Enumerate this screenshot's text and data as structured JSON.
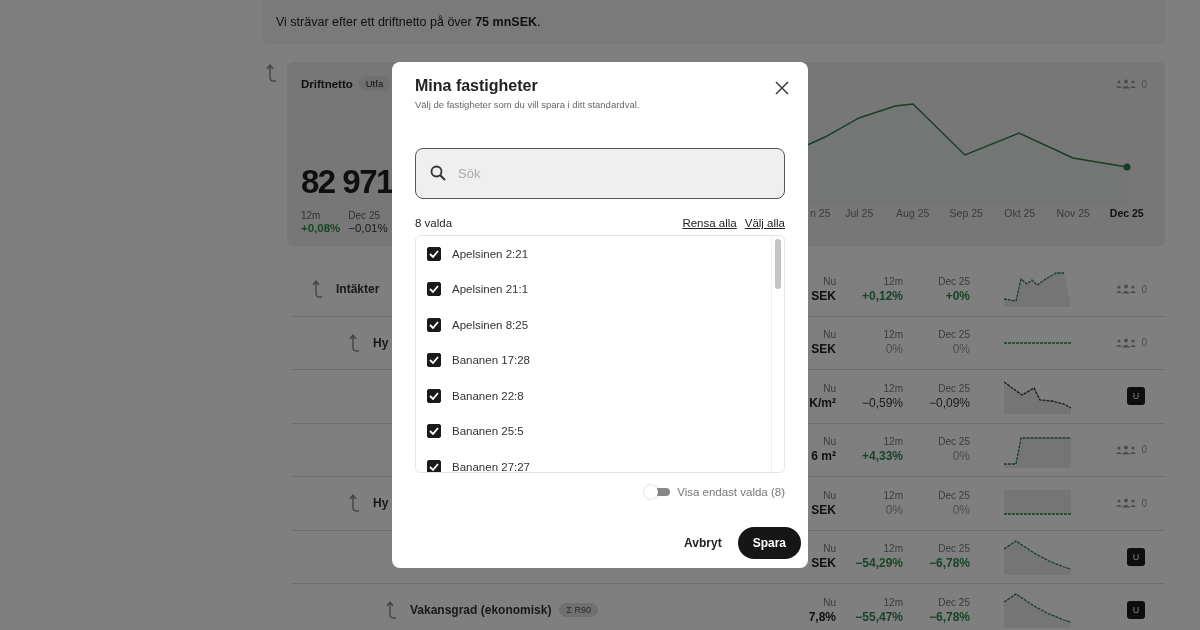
{
  "goal_banner": {
    "text": "Vi strävar efter ett driftnetto på över **75 mnSEK**."
  },
  "summary_card": {
    "title": "Driftnetto",
    "badge": "Utfa",
    "value": "82 971",
    "watchers": "0",
    "stats": [
      {
        "label": "12m",
        "value": "+0,08%",
        "kind": "good"
      },
      {
        "label": "Dec 25",
        "value": "−0,01%",
        "kind": "plain"
      }
    ],
    "months": [
      {
        "label": "n 25",
        "selected": false
      },
      {
        "label": "Jul 25",
        "selected": false
      },
      {
        "label": "Aug 25",
        "selected": false
      },
      {
        "label": "Sep 25",
        "selected": false
      },
      {
        "label": "Okt 25",
        "selected": false
      },
      {
        "label": "Nov 25",
        "selected": false
      },
      {
        "label": "Dec 25",
        "selected": true
      }
    ]
  },
  "rows": [
    {
      "name": "Intäkter",
      "sparkline": {
        "kind": "rise"
      },
      "marker": {
        "kind": "watchers",
        "text": "0"
      },
      "metrics": [
        {
          "label": "Nu",
          "value": "SEK",
          "kind": "strong"
        },
        {
          "label": "12m",
          "value": "+0,12%",
          "kind": "good"
        },
        {
          "label": "Dec 25",
          "value": "+0%",
          "kind": "good"
        }
      ],
      "children": [
        {
          "name": "Hy",
          "sparkline": {
            "kind": "flat"
          },
          "marker": {
            "kind": "watchers",
            "text": "0"
          },
          "metrics": [
            {
              "label": "Nu",
              "value": "SEK",
              "kind": "strong"
            },
            {
              "label": "12m",
              "value": "0%",
              "kind": "flat"
            },
            {
              "label": "Dec 25",
              "value": "0%",
              "kind": "flat"
            }
          ],
          "children": [
            {
              "sparkline": {
                "kind": "decline"
              },
              "marker": {
                "kind": "flag",
                "text": "U"
              },
              "metrics": [
                {
                  "label": "Nu",
                  "value": "K/m²",
                  "kind": "strong"
                },
                {
                  "label": "12m",
                  "value": "−0,59%",
                  "kind": "plain"
                },
                {
                  "label": "Dec 25",
                  "value": "−0,09%",
                  "kind": "plain"
                }
              ]
            },
            {
              "sparkline": {
                "kind": "step"
              },
              "marker": {
                "kind": "watchers",
                "text": "0"
              },
              "metrics": [
                {
                  "label": "Nu",
                  "value": "6 m²",
                  "kind": "strong"
                },
                {
                  "label": "12m",
                  "value": "+4,33%",
                  "kind": "good"
                },
                {
                  "label": "Dec 25",
                  "value": "0%",
                  "kind": "flat"
                }
              ]
            }
          ]
        },
        {
          "name": "Hy",
          "sparkline": {
            "kind": "band"
          },
          "marker": {
            "kind": "watchers",
            "text": "0"
          },
          "metrics": [
            {
              "label": "Nu",
              "value": "SEK",
              "kind": "strong"
            },
            {
              "label": "12m",
              "value": "0%",
              "kind": "flat"
            },
            {
              "label": "Dec 25",
              "value": "0%",
              "kind": "flat"
            }
          ],
          "children": [
            {
              "sparkline": {
                "kind": "peak"
              },
              "marker": {
                "kind": "flag",
                "text": "U"
              },
              "metrics": [
                {
                  "label": "Nu",
                  "value": "SEK",
                  "kind": "strong"
                },
                {
                  "label": "12m",
                  "value": "−54,29%",
                  "kind": "good"
                },
                {
                  "label": "Dec 25",
                  "value": "−6,78%",
                  "kind": "good"
                }
              ]
            },
            {
              "name": "Vakansgrad (ekonomisk)",
              "badge": "Σ R90",
              "sparkline": {
                "kind": "peak"
              },
              "marker": {
                "kind": "flag",
                "text": "U"
              },
              "metrics": [
                {
                  "label": "Nu",
                  "value": "7,8%",
                  "kind": "strong"
                },
                {
                  "label": "12m",
                  "value": "−55,47%",
                  "kind": "good"
                },
                {
                  "label": "Dec 25",
                  "value": "−6,78%",
                  "kind": "good"
                }
              ]
            }
          ]
        }
      ]
    }
  ],
  "dialog": {
    "title": "Mina fastigheter",
    "subtitle": "Välj de fastigheter som du vill spara i ditt standardval.",
    "search": {
      "placeholder": "Sök"
    },
    "selected_count": "8 valda",
    "clear_all": "Rensa alla",
    "select_all": "Välj alla",
    "properties": [
      {
        "name": "Apelsinen 2:21",
        "checked": true
      },
      {
        "name": "Apelsinen 21:1",
        "checked": true
      },
      {
        "name": "Apelsinen 8:25",
        "checked": true
      },
      {
        "name": "Bananen 17:28",
        "checked": true
      },
      {
        "name": "Bananen 22:8",
        "checked": true
      },
      {
        "name": "Bananen 25:5",
        "checked": true
      },
      {
        "name": "Bananen 27:27",
        "checked": true
      }
    ],
    "filter_toggle": {
      "label": "Visa endast valda (8)",
      "on": false
    },
    "buttons": [
      {
        "label": "Avbryt",
        "kind": "secondary"
      },
      {
        "label": "Spara",
        "kind": "primary"
      }
    ]
  }
}
